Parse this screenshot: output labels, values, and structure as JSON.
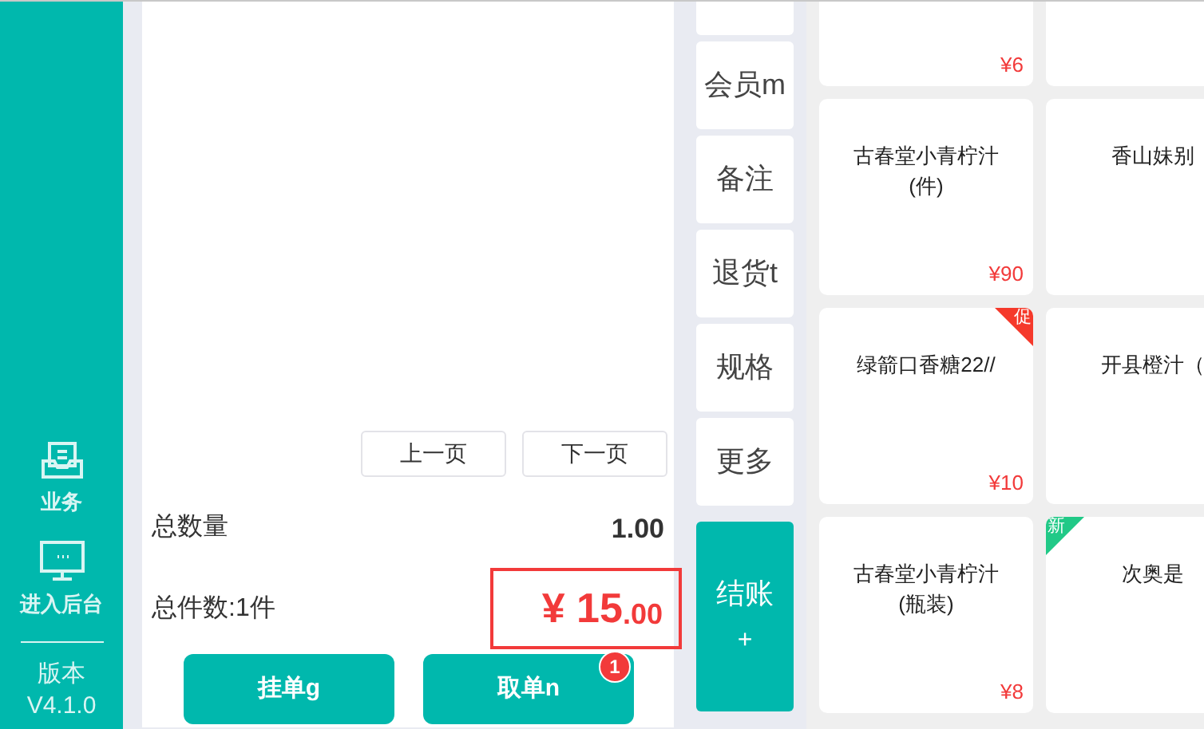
{
  "sidebar": {
    "items": [
      {
        "kind": "business",
        "label": "业务"
      },
      {
        "kind": "backend",
        "label": "进入后台"
      }
    ],
    "version_label": "版本",
    "version": "V4.1.0"
  },
  "order": {
    "pager": [
      "上一页",
      "下一页"
    ],
    "total_qty_label": "总数量",
    "total_qty": "1.00",
    "total_items": "总件数:1件",
    "currency": "¥",
    "amount_int": "15",
    "amount_dec": ".00",
    "buttons": [
      {
        "label": "挂单g"
      },
      {
        "label": "取单n",
        "badge": "1"
      }
    ]
  },
  "actions": [
    {
      "kind": "cut"
    },
    {
      "kind": "plain",
      "label": "会员m"
    },
    {
      "kind": "plain",
      "label": "备注"
    },
    {
      "kind": "plain",
      "label": "退货t"
    },
    {
      "kind": "plain",
      "label": "规格"
    },
    {
      "kind": "plain",
      "label": "更多"
    },
    {
      "kind": "checkout",
      "label": "结账",
      "sub": "+"
    }
  ],
  "products": [
    {
      "kind": "product",
      "price": "¥6"
    },
    {
      "kind": "blank"
    },
    {
      "kind": "product",
      "name": "古春堂小青柠汁",
      "name2": "(件)",
      "price": "¥90"
    },
    {
      "kind": "product",
      "name": "香山妹别"
    },
    {
      "kind": "product",
      "name": "绿箭口香糖22//",
      "price": "¥10",
      "tag": {
        "label": "促",
        "color": "#f5392b"
      }
    },
    {
      "kind": "product",
      "name": "开县橙汁（"
    },
    {
      "kind": "product",
      "name": "古春堂小青柠汁",
      "name2": "(瓶装)",
      "price": "¥8"
    },
    {
      "kind": "product",
      "name": "次奥是",
      "tag": {
        "label": "新",
        "color": "#21c987"
      }
    }
  ]
}
